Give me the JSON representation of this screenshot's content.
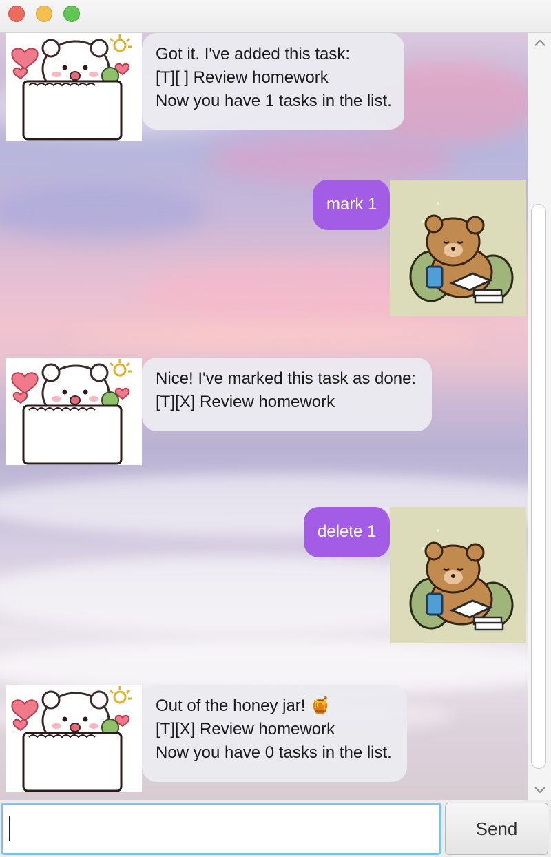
{
  "window": {
    "controls": {
      "close": "close-icon",
      "minimize": "minimize-icon",
      "zoom": "zoom-icon"
    }
  },
  "colors": {
    "user_bubble": "#a25ce6",
    "bot_bubble": "#eaeaf0",
    "input_focus": "#7cc3f2"
  },
  "messages": [
    {
      "sender": "bot",
      "lines": [
        "Got it. I've added this task:",
        "[T][ ] Review homework",
        "Now you have 1 tasks in the list."
      ]
    },
    {
      "sender": "user",
      "lines": [
        "mark 1"
      ]
    },
    {
      "sender": "bot",
      "lines": [
        "Nice! I've marked this task as done:",
        "[T][X] Review homework"
      ]
    },
    {
      "sender": "user",
      "lines": [
        "delete 1"
      ]
    },
    {
      "sender": "bot",
      "lines": [
        "Out of the honey jar! 🍯",
        "[T][X] Review homework",
        "Now you have 0 tasks in the list."
      ]
    }
  ],
  "input": {
    "value": "",
    "placeholder": ""
  },
  "send_button": {
    "label": "Send"
  },
  "scrollbar": {
    "up": "chevron-up-icon",
    "down": "chevron-down-icon"
  }
}
